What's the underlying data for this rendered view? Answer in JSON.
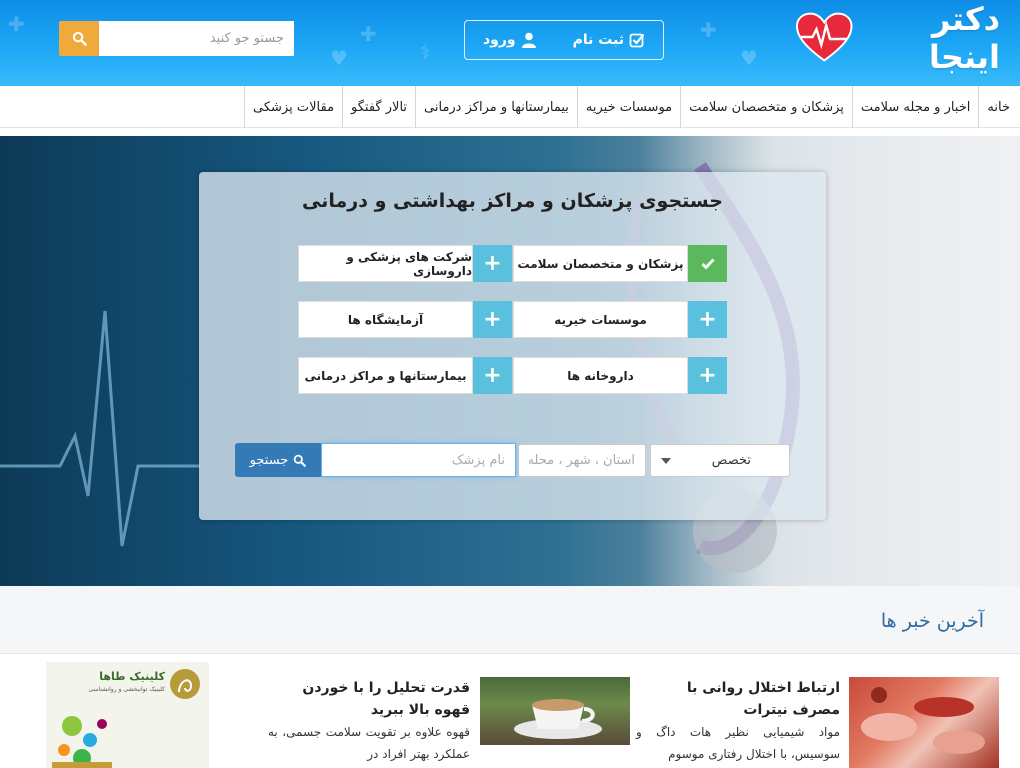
{
  "header": {
    "search_placeholder": "جستو جو کنید",
    "register_label": "ثبت نام",
    "login_label": "ورود",
    "logo_text": "دکتر اینجا"
  },
  "nav": {
    "items": [
      "خانه",
      "اخبار و مجله سلامت",
      "پزشکان و متخصصان سلامت",
      "موسسات خیریه",
      "بیمارستانها و مراکز درمانی",
      "تالار گفتگو",
      "مقالات پزشکی"
    ]
  },
  "search_panel": {
    "title": "جستجوی پزشکان و مراکز بهداشتی و درمانی",
    "categories": [
      {
        "label": "پزشکان و متخصصان سلامت",
        "selected": true
      },
      {
        "label": "شرکت های پزشکی و داروسازی",
        "selected": false
      },
      {
        "label": "موسسات خیریه",
        "selected": false
      },
      {
        "label": "آزمایشگاه ها",
        "selected": false
      },
      {
        "label": "داروخانه ها",
        "selected": false
      },
      {
        "label": "بیمارستانها و مراکز درمانی",
        "selected": false
      }
    ],
    "specialty_select": "تخصص",
    "location_placeholder": "استان ، شهر ، محله",
    "name_placeholder": "نام پزشک",
    "search_button": "جستجو"
  },
  "news": {
    "section_title": "آخرین خبر ها",
    "articles": [
      {
        "title": "ارتباط اختلال روانی با مصرف نیترات",
        "excerpt": "مواد شیمیایی نظیر هات داگ و سوسیس، با اختلال رفتاری موسوم"
      },
      {
        "title": "قدرت تحلیل را با خوردن قهوه بالا ببرید",
        "excerpt": "قهوه علاوه بر تقویت سلامت جسمی، به عملکرد بهتر افراد در"
      }
    ],
    "ad": {
      "title": "کلینیک طاها",
      "subtitle": "کلینیک توانبخشی و روانشناسی"
    }
  },
  "colors": {
    "header_blue": "#1da7f5",
    "search_orange": "#f2a93b",
    "category_plus": "#5bc0de",
    "category_checked": "#5cb85c",
    "primary_button": "#337ab7",
    "section_title": "#2b6ca3"
  },
  "icons": {
    "search": "search-icon",
    "user": "user-icon",
    "register": "checkbox-icon",
    "plus": "plus-icon",
    "check": "check-icon",
    "caret": "caret-down-icon"
  }
}
